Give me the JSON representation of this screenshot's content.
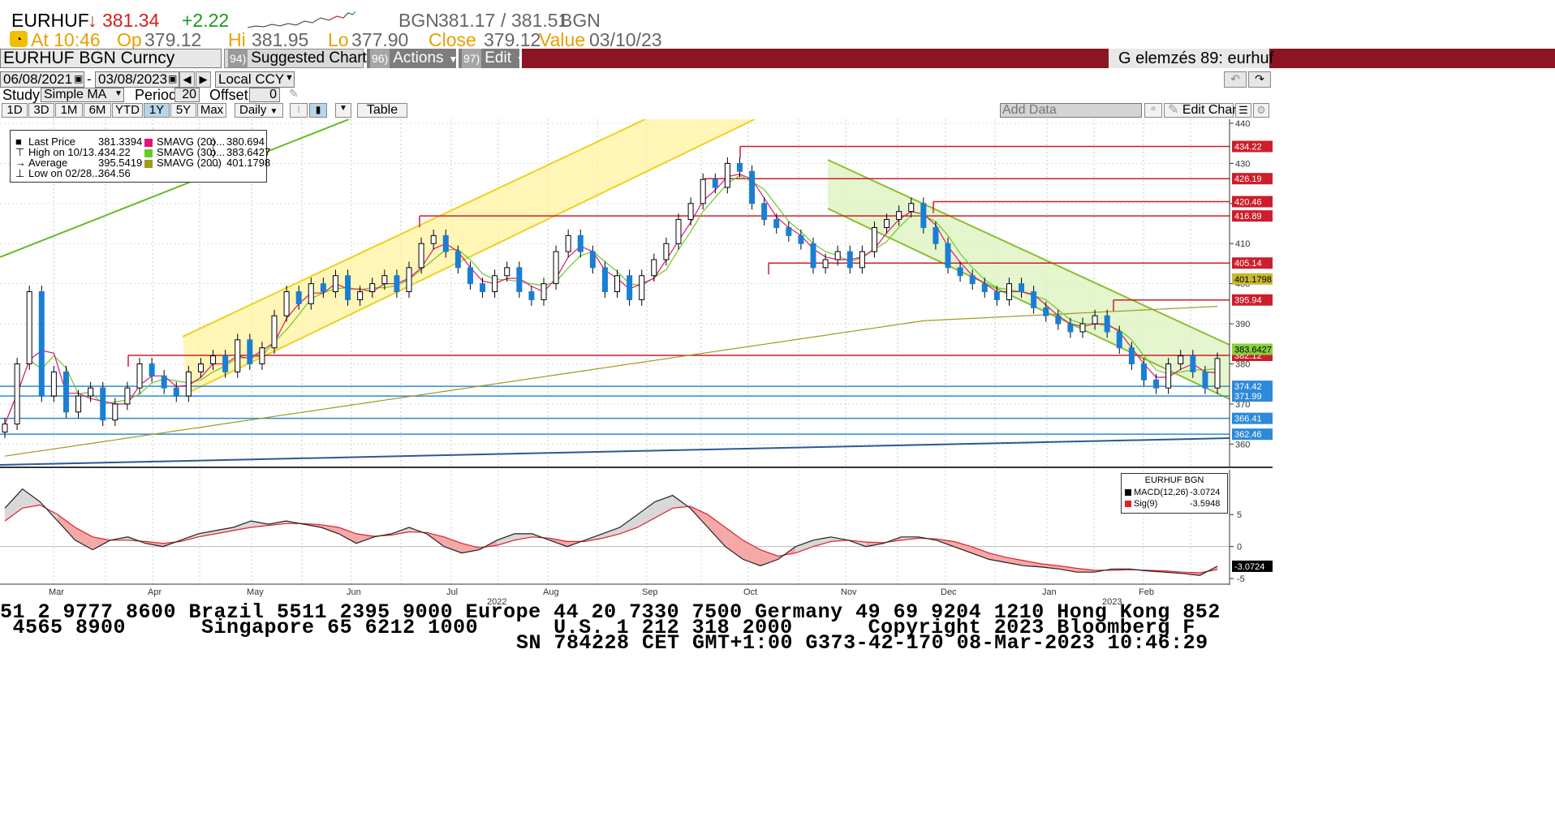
{
  "header": {
    "ticker": "EURHUF",
    "arrow": "↓",
    "last": "381.34",
    "change": "+2.22",
    "bgn_label": "BGN",
    "bid": "381.17",
    "ask": "381.51",
    "bgn_label2": "BGN",
    "time_label": "At 10:46",
    "op_label": "Op",
    "op_value": "379.12",
    "hi_label": "Hi",
    "hi_value": "381.95",
    "lo_label": "Lo",
    "lo_value": "377.90",
    "close_label": "Close",
    "close_value": "379.12",
    "value_label": "Value",
    "value_date": "03/10/23"
  },
  "toolbar": {
    "security": "EURHUF BGN Curncy",
    "suggested_num": "94)",
    "suggested_label": "Suggested Charts",
    "actions_num": "96)",
    "actions_label": "Actions",
    "edit_num": "97)",
    "edit_label": "Edit",
    "right_title": "G elemzés 89: eurhuf"
  },
  "controls": {
    "start_date": "06/08/2021",
    "end_date": "03/08/2023",
    "currency": "Local CCY",
    "study_label": "Study",
    "study_value": "Simple MA",
    "period_label": "Period",
    "period_value": "20",
    "offset_label": "Offset",
    "offset_value": "0",
    "ranges": [
      "1D",
      "3D",
      "1M",
      "6M",
      "YTD",
      "1Y",
      "5Y",
      "Max"
    ],
    "selected_range": "1Y",
    "frequency": "Daily",
    "table_label": "Table",
    "add_data_placeholder": "Add Data",
    "edit_chart_label": "Edit Chart"
  },
  "legend": {
    "rows": [
      {
        "label": "Last Price",
        "value": "381.3394",
        "color": "#000000"
      },
      {
        "label": "High on 10/13...",
        "value": "434.22",
        "color": ""
      },
      {
        "label": "Average",
        "value": "395.5419",
        "color": ""
      },
      {
        "label": "Low on 02/28...",
        "value": "364.56",
        "color": ""
      }
    ],
    "ma_rows": [
      {
        "label": "SMAVG (20)",
        "mid": "o...",
        "value": "380.694",
        "color": "#e0147a"
      },
      {
        "label": "SMAVG (30)",
        "mid": "o...",
        "value": "383.6427",
        "color": "#66cc22"
      },
      {
        "label": "SMAVG (200)",
        "mid": "...",
        "value": "401.1798",
        "color": "#a09a20"
      }
    ]
  },
  "macd_legend": {
    "title": "EURHUF BGN",
    "macd_label": "MACD(12,26)",
    "macd_value": "-3.0724",
    "sig_label": "Sig(9)",
    "sig_value": "-3.5948"
  },
  "chart_data": [
    {
      "type": "candlestick",
      "title": "",
      "y_ticks": [
        360,
        370,
        380,
        390,
        400,
        410,
        420,
        430,
        440
      ],
      "ylim": [
        354,
        441
      ],
      "x_labels": [
        "Mar",
        "Apr",
        "May",
        "Jun",
        "Jul",
        "Aug",
        "Sep",
        "Oct",
        "Nov",
        "Dec",
        "Jan",
        "Feb"
      ],
      "year_labels": [
        "2022",
        "2023"
      ],
      "horizontal_levels_red": [
        "434.22",
        "426.19",
        "420.46",
        "416.89",
        "405.14",
        "395.94",
        "382.12"
      ],
      "horizontal_levels_blue": [
        "374.42",
        "371.99",
        "366.41",
        "362.46"
      ],
      "right_badges": {
        "sma200": "401.1798",
        "sma30": "383.6427"
      },
      "close_series": [
        365,
        380,
        398,
        372,
        378,
        368,
        372,
        374,
        366,
        370,
        374,
        380,
        377,
        374,
        372,
        378,
        380,
        382,
        378,
        386,
        380,
        384,
        392,
        398,
        395,
        400,
        398,
        402,
        396,
        398,
        400,
        402,
        398,
        404,
        410,
        412,
        408,
        404,
        400,
        398,
        402,
        404,
        398,
        396,
        400,
        408,
        412,
        408,
        404,
        398,
        402,
        396,
        402,
        406,
        410,
        416,
        420,
        426,
        424,
        430,
        428,
        420,
        416,
        414,
        412,
        410,
        404,
        406,
        408,
        404,
        408,
        414,
        416,
        418,
        420,
        414,
        410,
        404,
        402,
        400,
        398,
        396,
        400,
        398,
        394,
        392,
        390,
        388,
        390,
        392,
        388,
        384,
        380,
        376,
        374,
        380,
        382,
        378,
        374,
        381.34
      ]
    },
    {
      "type": "line",
      "title": "",
      "y_ticks": [
        5,
        0,
        -5
      ],
      "ylim": [
        -6,
        12
      ],
      "series": [
        {
          "name": "MACD(12,26)",
          "values": [
            6,
            9,
            7,
            4,
            1,
            -0.5,
            1,
            1.5,
            0.5,
            0,
            1,
            2,
            2.5,
            3,
            4,
            3.5,
            4,
            3.5,
            3,
            2,
            0.5,
            1.5,
            2,
            3,
            2,
            0,
            -1,
            -0.5,
            1,
            2,
            2,
            1,
            0,
            1,
            2,
            3,
            5,
            7,
            8,
            6,
            3,
            0,
            -2,
            -3,
            -2,
            0,
            1,
            1.5,
            1,
            0,
            0.5,
            1.5,
            1.5,
            1,
            0,
            -1,
            -2,
            -2.5,
            -3,
            -3.2,
            -3.5,
            -4,
            -4,
            -3.5,
            -3.5,
            -3.8,
            -4,
            -4.2,
            -4.5,
            -3.07
          ]
        },
        {
          "name": "Sig(9)",
          "values": [
            4,
            6,
            6.5,
            5,
            3,
            1.5,
            1,
            1,
            0.8,
            0.5,
            0.8,
            1.5,
            2,
            2.5,
            3,
            3.3,
            3.6,
            3.6,
            3.4,
            3,
            2,
            1.6,
            1.8,
            2.3,
            2.2,
            1.5,
            0.5,
            -0.2,
            0.2,
            1,
            1.5,
            1.3,
            0.8,
            0.8,
            1.3,
            2,
            3,
            4.5,
            6,
            6.3,
            5,
            3,
            1,
            -0.5,
            -1.5,
            -1,
            0,
            0.8,
            1,
            0.7,
            0.6,
            1,
            1.3,
            1.2,
            0.8,
            0,
            -1,
            -1.7,
            -2.2,
            -2.7,
            -3,
            -3.4,
            -3.7,
            -3.7,
            -3.6,
            -3.7,
            -3.8,
            -4,
            -4.1,
            -3.59
          ]
        }
      ]
    }
  ],
  "footer": {
    "line1": "51 2 9777 8600 Brazil 5511 2395 9000 Europe 44 20 7330 7500 Germany 49 69 9204 1210 Hong Kong 852",
    "line2": " 4565 8900      Singapore 65 6212 1000      U.S. 1 212 318 2000      Copyright 2023 Bloomberg F",
    "line3": "SN 784228 CET  GMT+1:00 G373-42-170 08-Mar-2023 10:46:29"
  },
  "colors": {
    "price_up": "#000000",
    "price_down": "#1a7fd4",
    "red_level": "#cc1e2c",
    "blue_level": "#2e8ad8",
    "channel_yellow": "#fff3a0",
    "channel_green": "#dff3c2",
    "toolbar_red": "#8b1522"
  }
}
